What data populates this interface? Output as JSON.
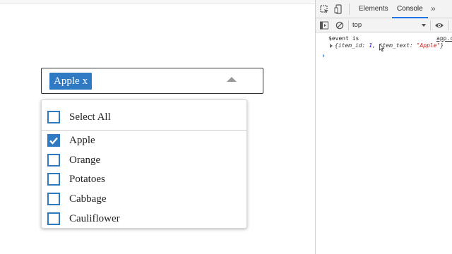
{
  "multiselect": {
    "selected_chip": {
      "label": "Apple",
      "remove": "x"
    },
    "select_all_label": "Select All",
    "options": [
      {
        "label": "Apple",
        "checked": true
      },
      {
        "label": "Orange",
        "checked": false
      },
      {
        "label": "Potatoes",
        "checked": false
      },
      {
        "label": "Cabbage",
        "checked": false
      },
      {
        "label": "Cauliflower",
        "checked": false
      }
    ],
    "colors": {
      "accent": "#2f7ac2",
      "border": "#333333"
    }
  },
  "devtools": {
    "tabs": [
      "Elements",
      "Console"
    ],
    "active_tab": "Console",
    "more_tabs": "»",
    "context": "top",
    "icons": [
      "inspect-icon",
      "device-toggle-icon",
      "sidebar-toggle-icon",
      "clear-console-icon",
      "eye-icon"
    ],
    "log": {
      "message": "$event is",
      "source_link": "app.c",
      "object_open": "{",
      "key1": "item_id",
      "value1": "1",
      "key2": "item_text",
      "value2": "\"Apple\"",
      "object_close": "}",
      "prompt": "›"
    }
  }
}
